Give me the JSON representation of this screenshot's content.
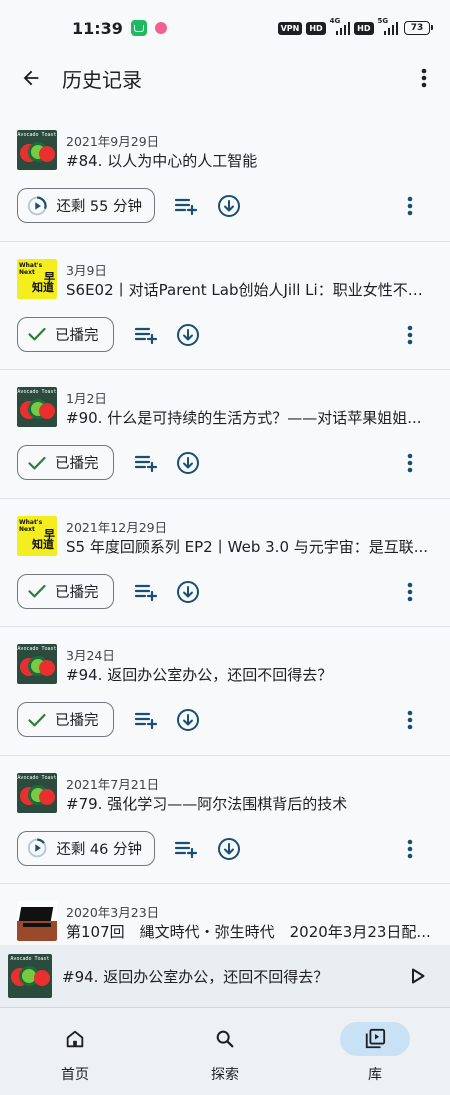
{
  "status_bar": {
    "time": "11:39",
    "vpn": "VPN",
    "hd1": "HD",
    "net1": "4G",
    "hd2": "HD",
    "net2": "5G",
    "battery": "73"
  },
  "app_bar": {
    "title": "历史记录"
  },
  "episodes": [
    {
      "thumb": "ainfo",
      "date": "2021年9月29日",
      "title": "#84. 以人为中心的人工智能",
      "status_type": "remaining",
      "status_label": "还剩 55 分钟",
      "progress": 0.3
    },
    {
      "thumb": "whatsnext",
      "date": "3月9日",
      "title": "S6E02丨对话Parent Lab创始人Jill Li：职业女性不必...",
      "status_type": "played",
      "status_label": "已播完"
    },
    {
      "thumb": "ainfo",
      "date": "1月2日",
      "title": "#90. 什么是可持续的生活方式？——对话苹果姐姐...",
      "status_type": "played",
      "status_label": "已播完"
    },
    {
      "thumb": "whatsnext",
      "date": "2021年12月29日",
      "title": "S5 年度回顾系列 EP2丨Web 3.0 与元宇宙：是互联...",
      "status_type": "played",
      "status_label": "已播完"
    },
    {
      "thumb": "ainfo",
      "date": "3月24日",
      "title": "#94. 返回办公室办公，还回不回得去？",
      "status_type": "played",
      "status_label": "已播完"
    },
    {
      "thumb": "ainfo",
      "date": "2021年7月21日",
      "title": "#79. 强化学习——阿尔法围棋背后的技术",
      "status_type": "remaining",
      "status_label": "还剩 46 分钟",
      "progress": 0.15
    }
  ],
  "partial_episode": {
    "thumb": "history",
    "date": "2020年3月23日",
    "title": "第107回　縄文時代・弥生時代　2020年3月23日配..."
  },
  "thumb_text": {
    "ainfo": "Avocado Toast",
    "whatsnext_1": "What's Next",
    "whatsnext_2": "早",
    "whatsnext_3": "知道"
  },
  "mini_player": {
    "title": "#94. 返回办公室办公，还回不回得去？"
  },
  "bottom_nav": [
    {
      "label": "首页",
      "icon": "home-icon",
      "active": false
    },
    {
      "label": "探索",
      "icon": "search-icon",
      "active": false
    },
    {
      "label": "库",
      "icon": "library-icon",
      "active": true
    }
  ],
  "colors": {
    "accent": "#1b4f72",
    "played_check": "#2e7d32",
    "background": "#f7f9fb",
    "nav_active": "#c9e1f5"
  }
}
